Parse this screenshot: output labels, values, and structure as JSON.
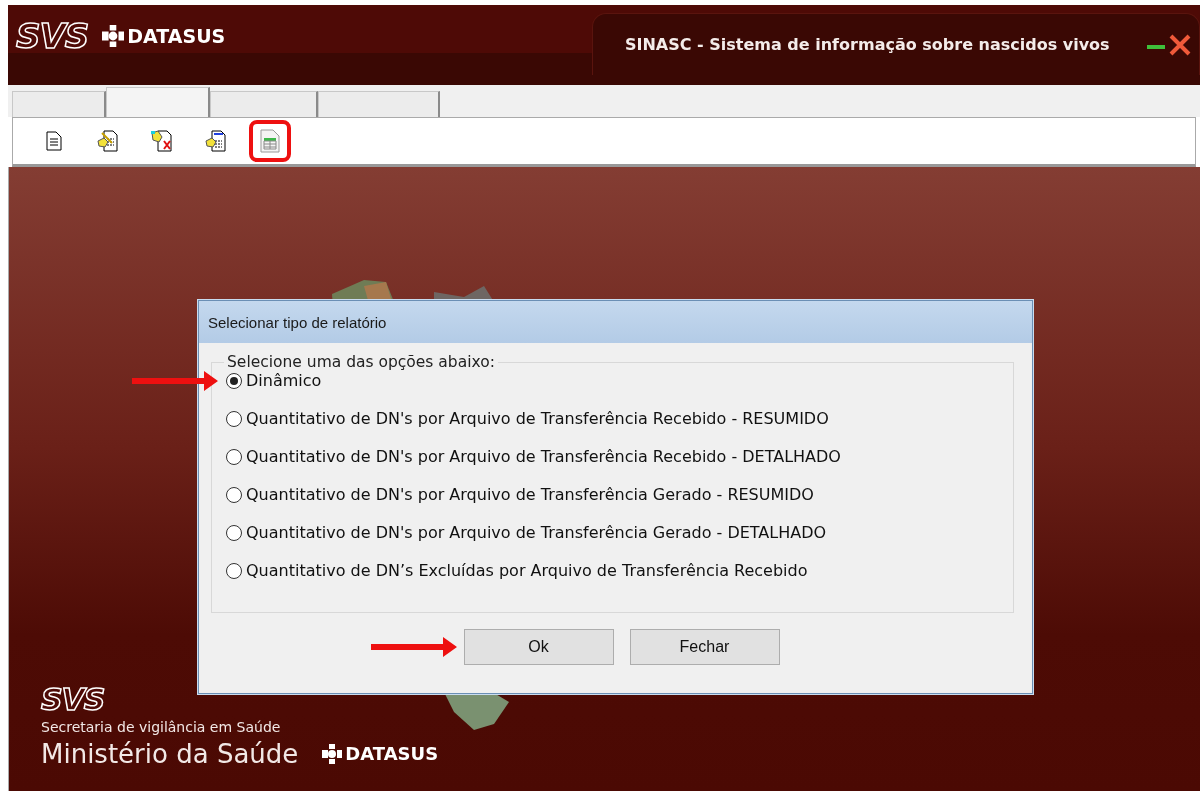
{
  "header": {
    "logo": "SVS",
    "brand": "DATASUS",
    "title": "SINASC - Sistema de informação sobre nascidos vivos"
  },
  "tabs": [
    {
      "selected": false
    },
    {
      "selected": true
    },
    {
      "selected": false
    },
    {
      "selected": false
    }
  ],
  "toolbar": [
    {
      "highlighted": false
    },
    {
      "highlighted": false
    },
    {
      "highlighted": false
    },
    {
      "highlighted": false
    },
    {
      "highlighted": true
    }
  ],
  "dialog": {
    "title": "Selecionar tipo de relatório",
    "group_label": "Selecione uma das opções abaixo:",
    "options": [
      {
        "label": "Dinâmico",
        "selected": true,
        "pointed": true
      },
      {
        "label": "Quantitativo de DN's por Arquivo de Transferência Recebido - RESUMIDO",
        "selected": false,
        "pointed": false
      },
      {
        "label": "Quantitativo de DN's por Arquivo de Transferência Recebido - DETALHADO",
        "selected": false,
        "pointed": false
      },
      {
        "label": "Quantitativo de DN's por Arquivo de Transferência Gerado - RESUMIDO",
        "selected": false,
        "pointed": false
      },
      {
        "label": "Quantitativo de DN's por Arquivo de Transferência Gerado - DETALHADO",
        "selected": false,
        "pointed": false
      },
      {
        "label": "Quantitativo de DN’s Excluídas por Arquivo de Transferência Recebido",
        "selected": false,
        "pointed": false
      }
    ],
    "buttons": [
      {
        "label": "Ok",
        "pointed": true
      },
      {
        "label": "Fechar",
        "pointed": false
      }
    ]
  },
  "footer": {
    "logo": "SVS",
    "subtitle": "Secretaria de vigilância em Saúde",
    "ministry": "Ministério da Saúde",
    "brand": "DATASUS"
  }
}
